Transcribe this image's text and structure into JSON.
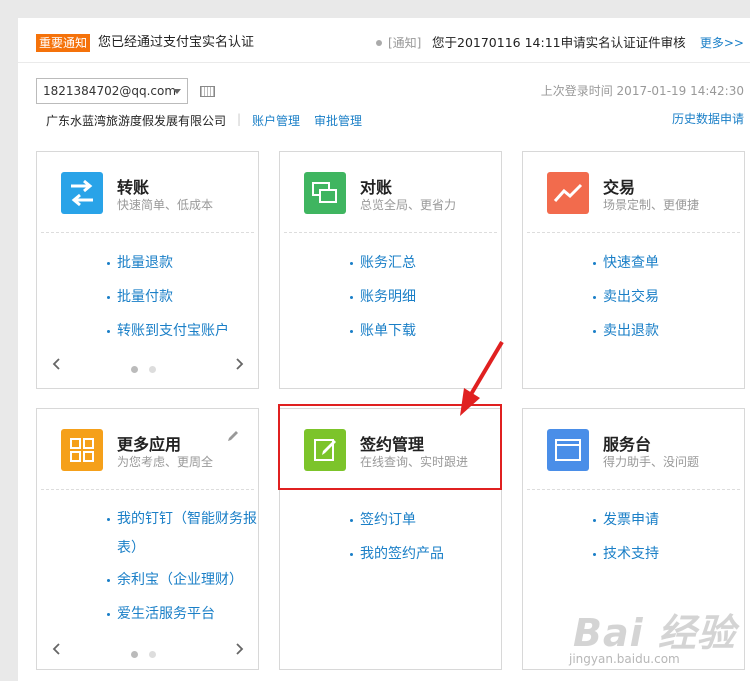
{
  "notice": {
    "tag": "重要通知",
    "text": "您已经通过支付宝实名认证",
    "category": "[通知]",
    "message": "您于20170116 14:11申请实名认证证件审核",
    "more": "更多>>"
  },
  "account": {
    "selected": "1821384702@qq.com",
    "last_login": "上次登录时间 2017-01-19 14:42:30",
    "company": "广东水蓝湾旅游度假发展有限公司",
    "separator": "|",
    "link_account": "账户管理",
    "link_approve": "审批管理",
    "link_history": "历史数据申请"
  },
  "tiles": [
    {
      "title": "转账",
      "subtitle": "快速简单、低成本",
      "color": "#29a3e8",
      "icon": "transfer-icon",
      "links": [
        "批量退款",
        "批量付款",
        "转账到支付宝账户"
      ]
    },
    {
      "title": "对账",
      "subtitle": "总览全局、更省力",
      "color": "#3fb560",
      "icon": "reconcile-icon",
      "links": [
        "账务汇总",
        "账务明细",
        "账单下载"
      ]
    },
    {
      "title": "交易",
      "subtitle": "场景定制、更便捷",
      "color": "#f26b4d",
      "icon": "trend-icon",
      "links": [
        "快速查单",
        "卖出交易",
        "卖出退款"
      ]
    },
    {
      "title": "更多应用",
      "subtitle": "为您考虑、更周全",
      "color": "#f5a01a",
      "icon": "grid-icon",
      "links": [
        "我的钉钉（智能财务报表）",
        "余利宝（企业理财）",
        "爱生活服务平台"
      ]
    },
    {
      "title": "签约管理",
      "subtitle": "在线查询、实时跟进",
      "color": "#7cc42a",
      "icon": "sign-icon",
      "links": [
        "签约订单",
        "我的签约产品"
      ]
    },
    {
      "title": "服务台",
      "subtitle": "得力助手、没问题",
      "color": "#4a8ee8",
      "icon": "window-icon",
      "links": [
        "发票申请",
        "技术支持"
      ]
    }
  ],
  "watermark": {
    "main": "Bai 经验",
    "sub": "jingyan.baidu.com"
  }
}
